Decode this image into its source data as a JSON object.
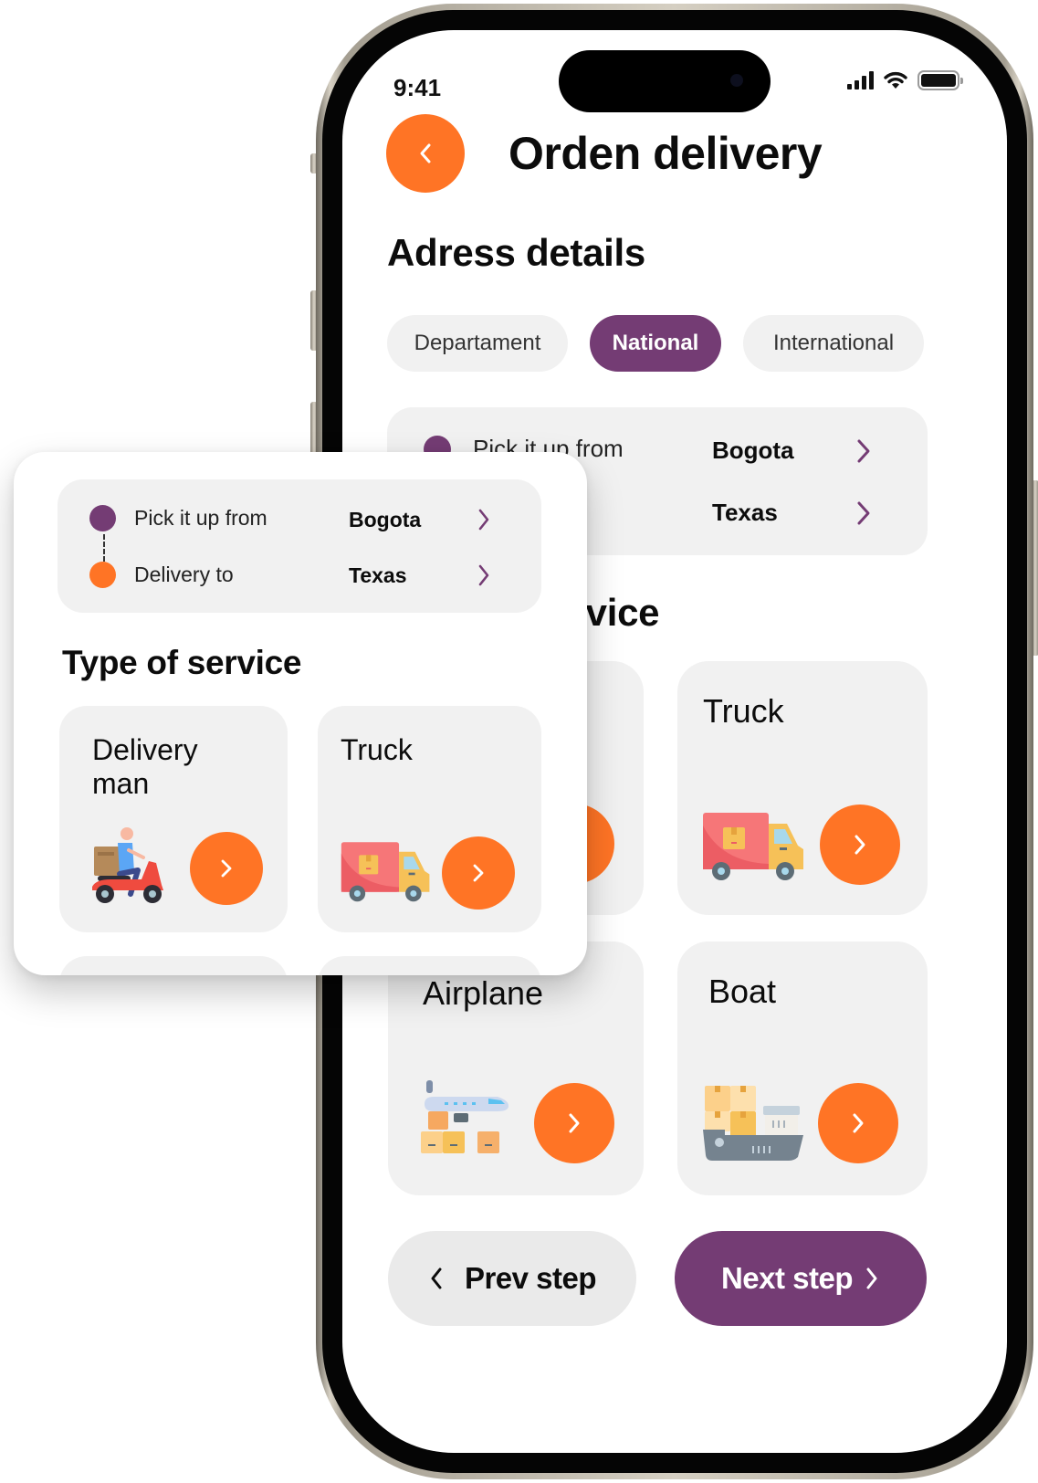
{
  "status_bar": {
    "time": "9:41",
    "icons": [
      "cellular-signal-icon",
      "wifi-icon",
      "battery-icon"
    ]
  },
  "header": {
    "back_icon": "chevron-left-icon",
    "title": "Orden delivery"
  },
  "address_section": {
    "title": "Adress details",
    "tabs": [
      {
        "label": "Departament",
        "active": false
      },
      {
        "label": "National",
        "active": true
      },
      {
        "label": "International",
        "active": false
      }
    ],
    "route": {
      "pickup": {
        "label": "Pick it up from",
        "value": "Bogota",
        "dot_color": "#743c74"
      },
      "delivery": {
        "label": "Delivery to",
        "value": "Texas",
        "dot_color": "#ff7425"
      }
    }
  },
  "service_section": {
    "title": "Type of service",
    "title_visible_fragment": "vice",
    "services": [
      {
        "label": "Delivery man",
        "line1": "Delivery",
        "line2": "man",
        "icon": "scooter-courier-icon"
      },
      {
        "label": "Truck",
        "icon": "delivery-truck-icon"
      },
      {
        "label": "Airplane",
        "icon": "cargo-airplane-icon"
      },
      {
        "label": "Boat",
        "icon": "cargo-ship-icon"
      }
    ]
  },
  "footer": {
    "prev_label": "Prev step",
    "next_label": "Next step"
  },
  "colors": {
    "accent_orange": "#ff7425",
    "brand_purple": "#743c74",
    "card_gray": "#f1f1f1"
  }
}
